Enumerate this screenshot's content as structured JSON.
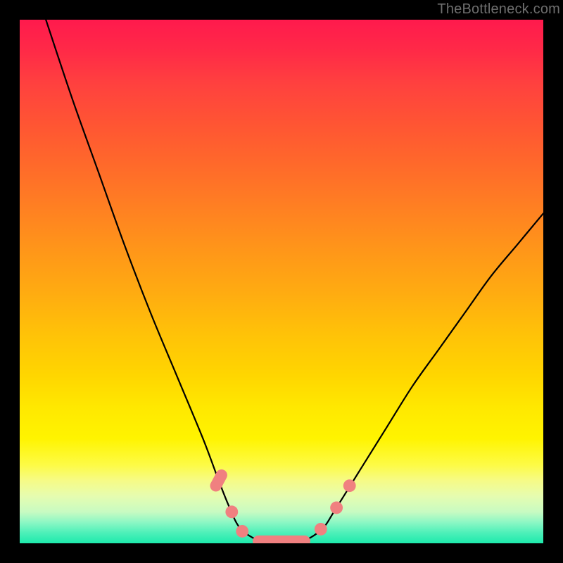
{
  "watermark": "TheBottleneck.com",
  "chart_data": {
    "type": "line",
    "title": "",
    "xlabel": "",
    "ylabel": "",
    "xlim": [
      0,
      100
    ],
    "ylim": [
      0,
      100
    ],
    "grid": false,
    "series": [
      {
        "name": "curve",
        "color": "#000000",
        "x": [
          5,
          10,
          15,
          20,
          25,
          30,
          35,
          38,
          40,
          42,
          45,
          48,
          52,
          55,
          58,
          60,
          65,
          70,
          75,
          80,
          85,
          90,
          95,
          100
        ],
        "y": [
          100,
          85,
          71,
          57,
          44,
          32,
          20,
          12,
          7,
          3,
          0.8,
          0,
          0,
          0.8,
          3,
          6,
          14,
          22,
          30,
          37,
          44,
          51,
          57,
          63
        ]
      }
    ],
    "markers": [
      {
        "shape": "pill",
        "cx": 38.0,
        "cy": 12.0,
        "w": 4.5,
        "h": 2.2,
        "angle": -62,
        "color": "#f08080"
      },
      {
        "shape": "circle",
        "cx": 40.5,
        "cy": 6.0,
        "r": 1.2,
        "color": "#f08080"
      },
      {
        "shape": "circle",
        "cx": 42.5,
        "cy": 2.3,
        "r": 1.2,
        "color": "#f08080"
      },
      {
        "shape": "pill",
        "cx": 50.0,
        "cy": 0.4,
        "w": 11.0,
        "h": 2.2,
        "angle": 0,
        "color": "#f08080"
      },
      {
        "shape": "circle",
        "cx": 57.5,
        "cy": 2.7,
        "r": 1.2,
        "color": "#f08080"
      },
      {
        "shape": "circle",
        "cx": 60.5,
        "cy": 6.8,
        "r": 1.2,
        "color": "#f08080"
      },
      {
        "shape": "circle",
        "cx": 63.0,
        "cy": 11.0,
        "r": 1.2,
        "color": "#f08080"
      }
    ]
  }
}
